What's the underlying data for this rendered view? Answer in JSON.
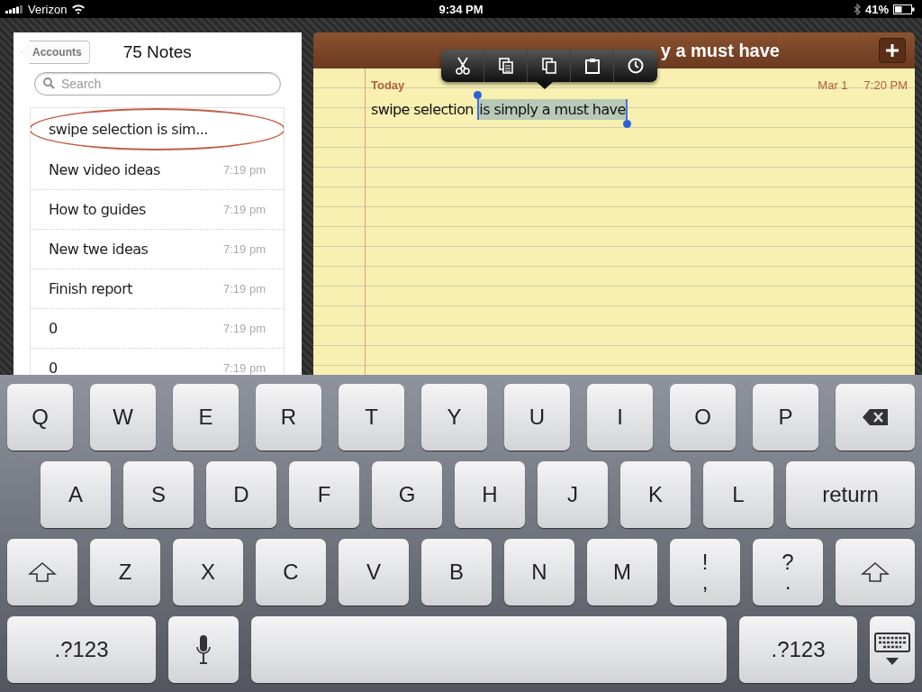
{
  "status_bar": {
    "carrier": "Verizon",
    "time": "9:34 PM",
    "battery": "41%"
  },
  "notes_list": {
    "back_button": "Accounts",
    "title": "75 Notes",
    "search": {
      "placeholder": "Search"
    },
    "items": [
      {
        "title": "swipe selection is sim...",
        "selected": true
      },
      {
        "title": "New video ideas",
        "time": "7:19 pm",
        "selected": false
      },
      {
        "title": "How to guides",
        "time": "7:19 pm",
        "selected": false
      },
      {
        "title": "New twe ideas",
        "time": "7:19 pm",
        "selected": false
      },
      {
        "title": "Finish report",
        "time": "7:19 pm",
        "selected": false
      },
      {
        "title": "0",
        "time": "7:19 pm",
        "selected": false
      },
      {
        "title": "0",
        "time": "7:19 pm",
        "selected": false
      }
    ]
  },
  "note": {
    "title": "y a must have",
    "day": "Today",
    "date": "Mar 1",
    "time": "7:20 PM",
    "text": "swipe selection ",
    "selected_text": "is simply a must have"
  },
  "edit_menu": [
    {
      "kind": "cut"
    },
    {
      "kind": "copy"
    },
    {
      "kind": "duplicate"
    },
    {
      "kind": "paste"
    },
    {
      "kind": "clock"
    }
  ],
  "keyboard": [
    [
      {
        "kind": "letter",
        "label": "Q"
      },
      {
        "kind": "letter",
        "label": "W"
      },
      {
        "kind": "letter",
        "label": "E"
      },
      {
        "kind": "letter",
        "label": "R"
      },
      {
        "kind": "letter",
        "label": "T"
      },
      {
        "kind": "letter",
        "label": "Y"
      },
      {
        "kind": "letter",
        "label": "U"
      },
      {
        "kind": "letter",
        "label": "I"
      },
      {
        "kind": "letter",
        "label": "O"
      },
      {
        "kind": "letter",
        "label": "P"
      },
      {
        "kind": "backspace"
      }
    ],
    [
      {
        "kind": "letter",
        "label": "A"
      },
      {
        "kind": "letter",
        "label": "S"
      },
      {
        "kind": "letter",
        "label": "D"
      },
      {
        "kind": "letter",
        "label": "F"
      },
      {
        "kind": "letter",
        "label": "G"
      },
      {
        "kind": "letter",
        "label": "H"
      },
      {
        "kind": "letter",
        "label": "J"
      },
      {
        "kind": "letter",
        "label": "K"
      },
      {
        "kind": "letter",
        "label": "L"
      },
      {
        "kind": "return",
        "label": "return"
      }
    ],
    [
      {
        "kind": "shift"
      },
      {
        "kind": "letter",
        "label": "Z"
      },
      {
        "kind": "letter",
        "label": "X"
      },
      {
        "kind": "letter",
        "label": "C"
      },
      {
        "kind": "letter",
        "label": "V"
      },
      {
        "kind": "letter",
        "label": "B"
      },
      {
        "kind": "letter",
        "label": "N"
      },
      {
        "kind": "letter",
        "label": "M"
      },
      {
        "kind": "punct",
        "top": "!",
        "bottom": ","
      },
      {
        "kind": "punct",
        "top": "?",
        "bottom": "."
      },
      {
        "kind": "shift"
      }
    ],
    [
      {
        "kind": "numbers",
        "label": ".?123"
      },
      {
        "kind": "mic"
      },
      {
        "kind": "space"
      },
      {
        "kind": "numbers",
        "label": ".?123"
      },
      {
        "kind": "hide"
      }
    ]
  ]
}
